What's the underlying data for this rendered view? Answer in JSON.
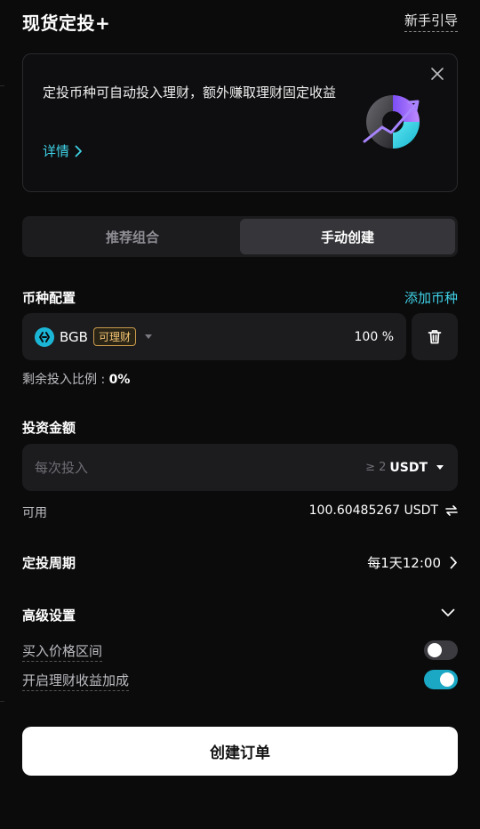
{
  "header": {
    "title": "现货定投+",
    "guide_label": "新手引导"
  },
  "banner": {
    "text": "定投币种可自动投入理财，额外赚取理财固定收益",
    "link_label": "详情",
    "close_icon": "close-icon",
    "art_icon": "chart-growth-illustration"
  },
  "tabs": [
    {
      "label": "推荐组合",
      "active": false
    },
    {
      "label": "手动创建",
      "active": true
    }
  ],
  "coin_config": {
    "label": "币种配置",
    "add_label": "添加币种",
    "coin": {
      "name": "BGB",
      "badge": "可理财",
      "percent": "100 %"
    },
    "remaining_label": "剩余投入比例 :",
    "remaining_value": "0%"
  },
  "investment": {
    "label": "投资金额",
    "placeholder": "每次投入",
    "min": "≥ 2",
    "unit": "USDT"
  },
  "available": {
    "label": "可用",
    "value": "100.60485267 USDT"
  },
  "period": {
    "label": "定投周期",
    "value": "每1天12:00"
  },
  "advanced": {
    "label": "高级设置",
    "price_range_label": "买入价格区间",
    "price_range_on": false,
    "earn_boost_label": "开启理财收益加成",
    "earn_boost_on": true
  },
  "submit_label": "创建订单",
  "colors": {
    "accent": "#3fd2e6",
    "toggle_on": "#1aa8c4",
    "badge": "#f3c573",
    "background": "#0b0b0c",
    "field": "#1c1c1f"
  }
}
